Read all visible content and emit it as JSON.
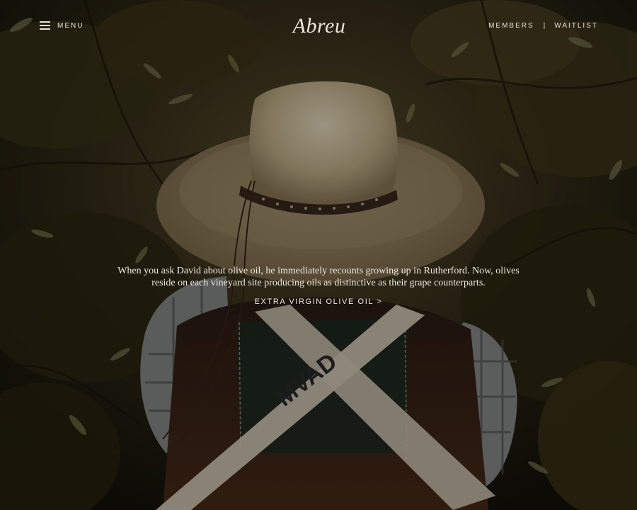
{
  "nav": {
    "menu_label": "MENU",
    "logo": "Abreu",
    "members_label": "MEMBERS",
    "separator": "|",
    "waitlist_label": "WAITLIST"
  },
  "hero": {
    "description": "When you ask David about olive oil, he immediately recounts growing up in Rutherford. Now, olives reside on each vineyard site producing oils as distinctive as their grape counterparts.",
    "cta_label": "EXTRA VIRGIN OLIVE OIL >",
    "strap_text": "MVAD"
  },
  "icons": {
    "menu": "hamburger-icon"
  }
}
